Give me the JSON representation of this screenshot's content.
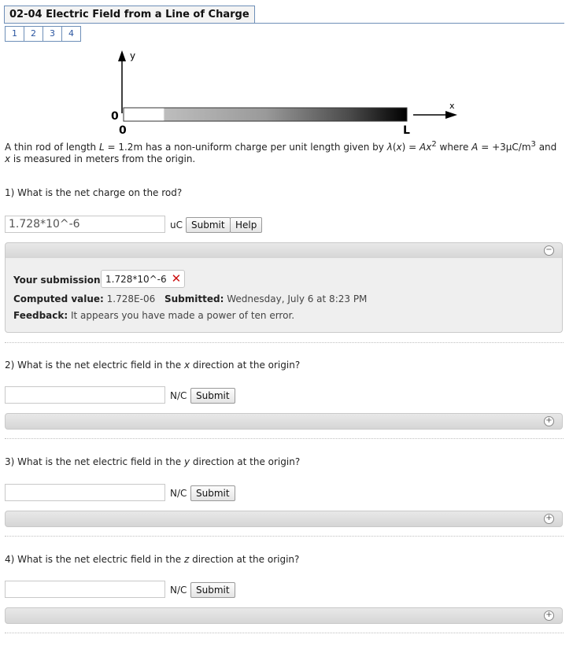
{
  "title": "02-04 Electric Field from a Line of Charge",
  "pages": [
    "1",
    "2",
    "3",
    "4"
  ],
  "diagram": {
    "y_axis_label": "y",
    "x_axis_label": "x",
    "origin_label_left": "0",
    "origin_label_below": "0",
    "end_label": "L"
  },
  "problem": {
    "t1": "A thin rod of length ",
    "L": "L",
    "t2": " = 1.2m has a non-uniform charge per unit length given by ",
    "lambda": "λ",
    "t3": "(",
    "x1": "x",
    "t4": ") = ",
    "A1": "Ax",
    "sup1": "2",
    "t5": " where ",
    "A2": "A",
    "t6": " = +3μC/m",
    "sup2": "3",
    "t7": " and ",
    "x2": "x",
    "t8": " is measured in meters from the origin."
  },
  "q1": {
    "text": "1) What is the net charge on the rod?",
    "input_value": "1.728*10^-6",
    "unit": "uC",
    "submit": "Submit",
    "help": "Help",
    "panel": {
      "submissions_label": "Your submissions:",
      "submission_value": "1.728*10^-6",
      "computed_label": "Computed value:",
      "computed_value": "1.728E-06",
      "submitted_label": "Submitted:",
      "submitted_value": "Wednesday, July 6 at 8:23 PM",
      "feedback_label": "Feedback:",
      "feedback_value": "It appears you have made a power of ten error."
    }
  },
  "q2": {
    "pre": "2) What is the net electric field in the ",
    "var": "x",
    "post": " direction at the origin?",
    "unit": "N/C",
    "submit": "Submit"
  },
  "q3": {
    "pre": "3) What is the net electric field in the ",
    "var": "y",
    "post": " direction at the origin?",
    "unit": "N/C",
    "submit": "Submit"
  },
  "q4": {
    "pre": "4) What is the net electric field in the ",
    "var": "z",
    "post": " direction at the origin?",
    "unit": "N/C",
    "submit": "Submit"
  },
  "colors": {
    "accent": "#6e8fb8",
    "link": "#2a55a0",
    "error": "#cc1111"
  }
}
